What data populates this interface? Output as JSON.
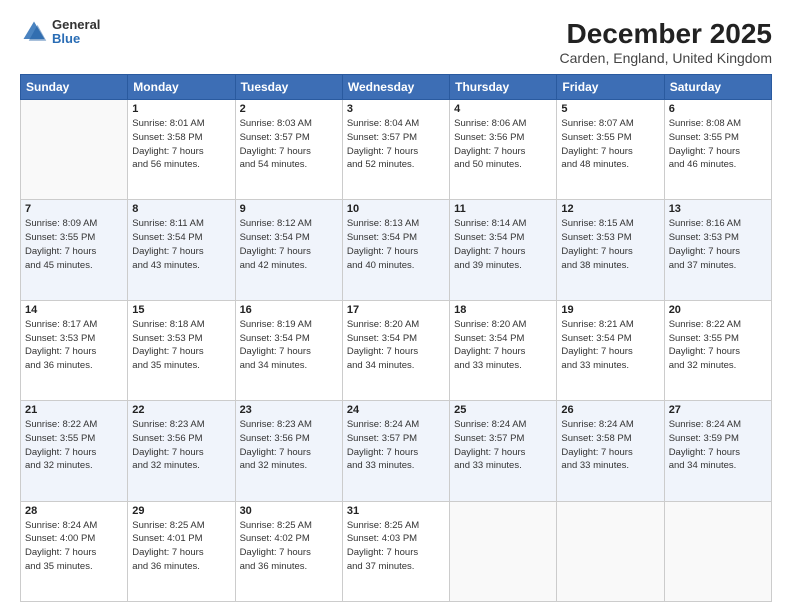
{
  "header": {
    "logo": {
      "general": "General",
      "blue": "Blue"
    },
    "title": "December 2025",
    "subtitle": "Carden, England, United Kingdom"
  },
  "weekdays": [
    "Sunday",
    "Monday",
    "Tuesday",
    "Wednesday",
    "Thursday",
    "Friday",
    "Saturday"
  ],
  "weeks": [
    [
      {
        "day": "",
        "info": ""
      },
      {
        "day": "1",
        "info": "Sunrise: 8:01 AM\nSunset: 3:58 PM\nDaylight: 7 hours\nand 56 minutes."
      },
      {
        "day": "2",
        "info": "Sunrise: 8:03 AM\nSunset: 3:57 PM\nDaylight: 7 hours\nand 54 minutes."
      },
      {
        "day": "3",
        "info": "Sunrise: 8:04 AM\nSunset: 3:57 PM\nDaylight: 7 hours\nand 52 minutes."
      },
      {
        "day": "4",
        "info": "Sunrise: 8:06 AM\nSunset: 3:56 PM\nDaylight: 7 hours\nand 50 minutes."
      },
      {
        "day": "5",
        "info": "Sunrise: 8:07 AM\nSunset: 3:55 PM\nDaylight: 7 hours\nand 48 minutes."
      },
      {
        "day": "6",
        "info": "Sunrise: 8:08 AM\nSunset: 3:55 PM\nDaylight: 7 hours\nand 46 minutes."
      }
    ],
    [
      {
        "day": "7",
        "info": "Sunrise: 8:09 AM\nSunset: 3:55 PM\nDaylight: 7 hours\nand 45 minutes."
      },
      {
        "day": "8",
        "info": "Sunrise: 8:11 AM\nSunset: 3:54 PM\nDaylight: 7 hours\nand 43 minutes."
      },
      {
        "day": "9",
        "info": "Sunrise: 8:12 AM\nSunset: 3:54 PM\nDaylight: 7 hours\nand 42 minutes."
      },
      {
        "day": "10",
        "info": "Sunrise: 8:13 AM\nSunset: 3:54 PM\nDaylight: 7 hours\nand 40 minutes."
      },
      {
        "day": "11",
        "info": "Sunrise: 8:14 AM\nSunset: 3:54 PM\nDaylight: 7 hours\nand 39 minutes."
      },
      {
        "day": "12",
        "info": "Sunrise: 8:15 AM\nSunset: 3:53 PM\nDaylight: 7 hours\nand 38 minutes."
      },
      {
        "day": "13",
        "info": "Sunrise: 8:16 AM\nSunset: 3:53 PM\nDaylight: 7 hours\nand 37 minutes."
      }
    ],
    [
      {
        "day": "14",
        "info": "Sunrise: 8:17 AM\nSunset: 3:53 PM\nDaylight: 7 hours\nand 36 minutes."
      },
      {
        "day": "15",
        "info": "Sunrise: 8:18 AM\nSunset: 3:53 PM\nDaylight: 7 hours\nand 35 minutes."
      },
      {
        "day": "16",
        "info": "Sunrise: 8:19 AM\nSunset: 3:54 PM\nDaylight: 7 hours\nand 34 minutes."
      },
      {
        "day": "17",
        "info": "Sunrise: 8:20 AM\nSunset: 3:54 PM\nDaylight: 7 hours\nand 34 minutes."
      },
      {
        "day": "18",
        "info": "Sunrise: 8:20 AM\nSunset: 3:54 PM\nDaylight: 7 hours\nand 33 minutes."
      },
      {
        "day": "19",
        "info": "Sunrise: 8:21 AM\nSunset: 3:54 PM\nDaylight: 7 hours\nand 33 minutes."
      },
      {
        "day": "20",
        "info": "Sunrise: 8:22 AM\nSunset: 3:55 PM\nDaylight: 7 hours\nand 32 minutes."
      }
    ],
    [
      {
        "day": "21",
        "info": "Sunrise: 8:22 AM\nSunset: 3:55 PM\nDaylight: 7 hours\nand 32 minutes."
      },
      {
        "day": "22",
        "info": "Sunrise: 8:23 AM\nSunset: 3:56 PM\nDaylight: 7 hours\nand 32 minutes."
      },
      {
        "day": "23",
        "info": "Sunrise: 8:23 AM\nSunset: 3:56 PM\nDaylight: 7 hours\nand 32 minutes."
      },
      {
        "day": "24",
        "info": "Sunrise: 8:24 AM\nSunset: 3:57 PM\nDaylight: 7 hours\nand 33 minutes."
      },
      {
        "day": "25",
        "info": "Sunrise: 8:24 AM\nSunset: 3:57 PM\nDaylight: 7 hours\nand 33 minutes."
      },
      {
        "day": "26",
        "info": "Sunrise: 8:24 AM\nSunset: 3:58 PM\nDaylight: 7 hours\nand 33 minutes."
      },
      {
        "day": "27",
        "info": "Sunrise: 8:24 AM\nSunset: 3:59 PM\nDaylight: 7 hours\nand 34 minutes."
      }
    ],
    [
      {
        "day": "28",
        "info": "Sunrise: 8:24 AM\nSunset: 4:00 PM\nDaylight: 7 hours\nand 35 minutes."
      },
      {
        "day": "29",
        "info": "Sunrise: 8:25 AM\nSunset: 4:01 PM\nDaylight: 7 hours\nand 36 minutes."
      },
      {
        "day": "30",
        "info": "Sunrise: 8:25 AM\nSunset: 4:02 PM\nDaylight: 7 hours\nand 36 minutes."
      },
      {
        "day": "31",
        "info": "Sunrise: 8:25 AM\nSunset: 4:03 PM\nDaylight: 7 hours\nand 37 minutes."
      },
      {
        "day": "",
        "info": ""
      },
      {
        "day": "",
        "info": ""
      },
      {
        "day": "",
        "info": ""
      }
    ]
  ]
}
